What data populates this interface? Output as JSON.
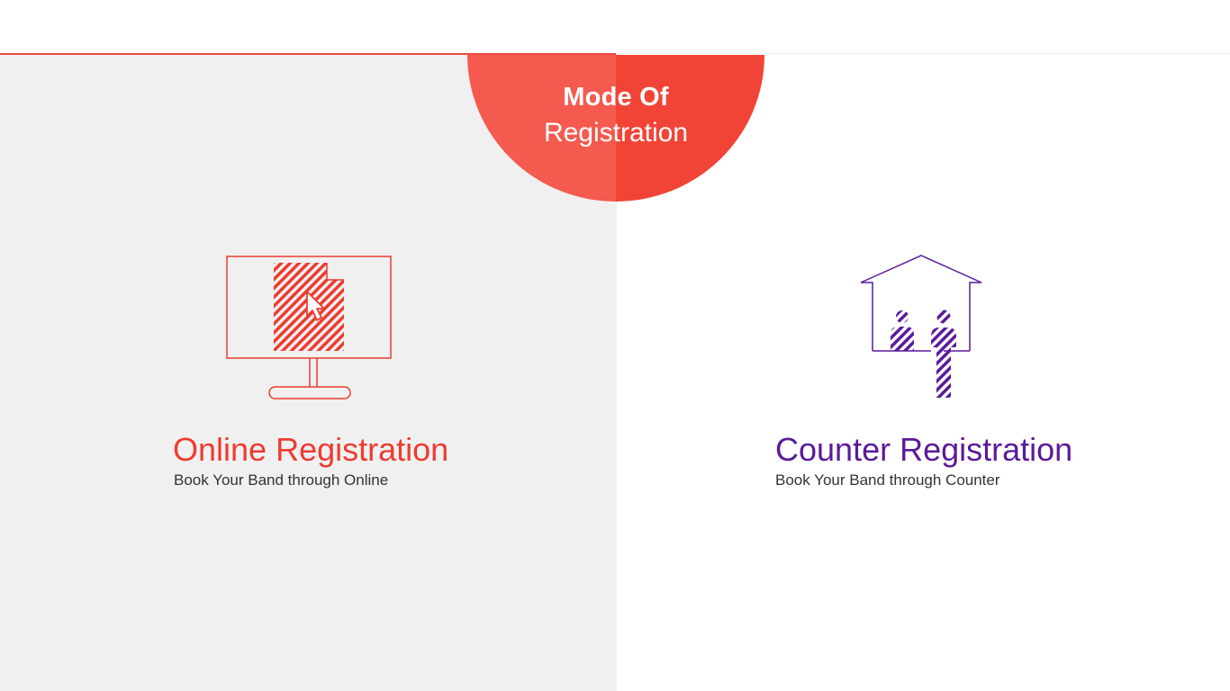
{
  "header": {
    "badge_line1": "Mode Of",
    "badge_line2": "Registration"
  },
  "options": {
    "online": {
      "title": "Online Registration",
      "subtitle": "Book Your Band through Online",
      "icon": "computer-screen-document-icon",
      "color": "#ee3b2f"
    },
    "counter": {
      "title": "Counter Registration",
      "subtitle": "Book Your Band through Counter",
      "icon": "house-counter-people-icon",
      "color": "#5b1a99"
    }
  },
  "colors": {
    "accent": "#f04a3e",
    "badge_left": "#f55a4f",
    "badge_right": "#f24436",
    "left_panel": "#f0f0f0",
    "right_panel": "#ffffff"
  }
}
